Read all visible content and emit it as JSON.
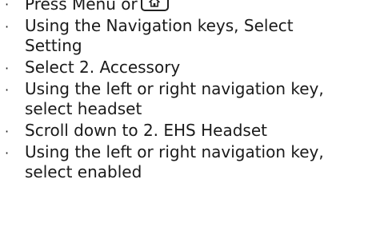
{
  "steps": [
    {
      "bullet": "·",
      "lines": [
        "Press Menu or"
      ],
      "icon": "home-icon"
    },
    {
      "bullet": "·",
      "lines": [
        "Using the Navigation keys, Select",
        "Setting"
      ]
    },
    {
      "bullet": "·",
      "lines": [
        "Select 2. Accessory"
      ]
    },
    {
      "bullet": "·",
      "lines": [
        "Using the left or right navigation key,",
        "select headset"
      ]
    },
    {
      "bullet": "·",
      "lines": [
        "Scroll down to 2. EHS Headset"
      ]
    },
    {
      "bullet": "·",
      "lines": [
        "Using the left or right navigation key,",
        "select enabled"
      ]
    }
  ]
}
